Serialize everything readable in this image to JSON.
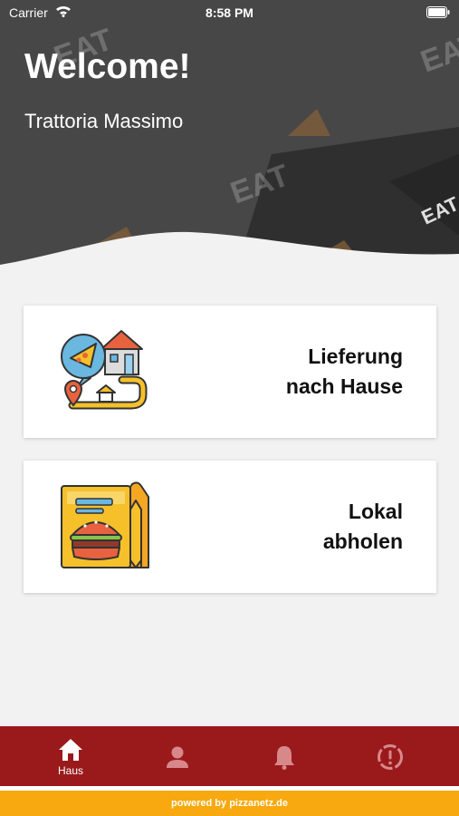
{
  "status_bar": {
    "carrier": "Carrier",
    "time": "8:58 PM"
  },
  "header": {
    "title": "Welcome!",
    "subtitle": "Trattoria Massimo"
  },
  "options": [
    {
      "line1": "Lieferung",
      "line2": "nach Hause",
      "icon": "delivery-route-icon"
    },
    {
      "line1": "Lokal",
      "line2": "abholen",
      "icon": "takeaway-bag-icon"
    }
  ],
  "tabs": [
    {
      "label": "Haus",
      "icon": "home-icon",
      "active": true
    },
    {
      "label": "",
      "icon": "profile-icon",
      "active": false
    },
    {
      "label": "",
      "icon": "bell-icon",
      "active": false
    },
    {
      "label": "",
      "icon": "info-icon",
      "active": false
    }
  ],
  "footer": {
    "text": "powered by pizzanetz.de"
  },
  "colors": {
    "tabbar": "#9a1a1c",
    "footer": "#f7a90f",
    "hero": "#454545",
    "background": "#f2f2f2"
  }
}
